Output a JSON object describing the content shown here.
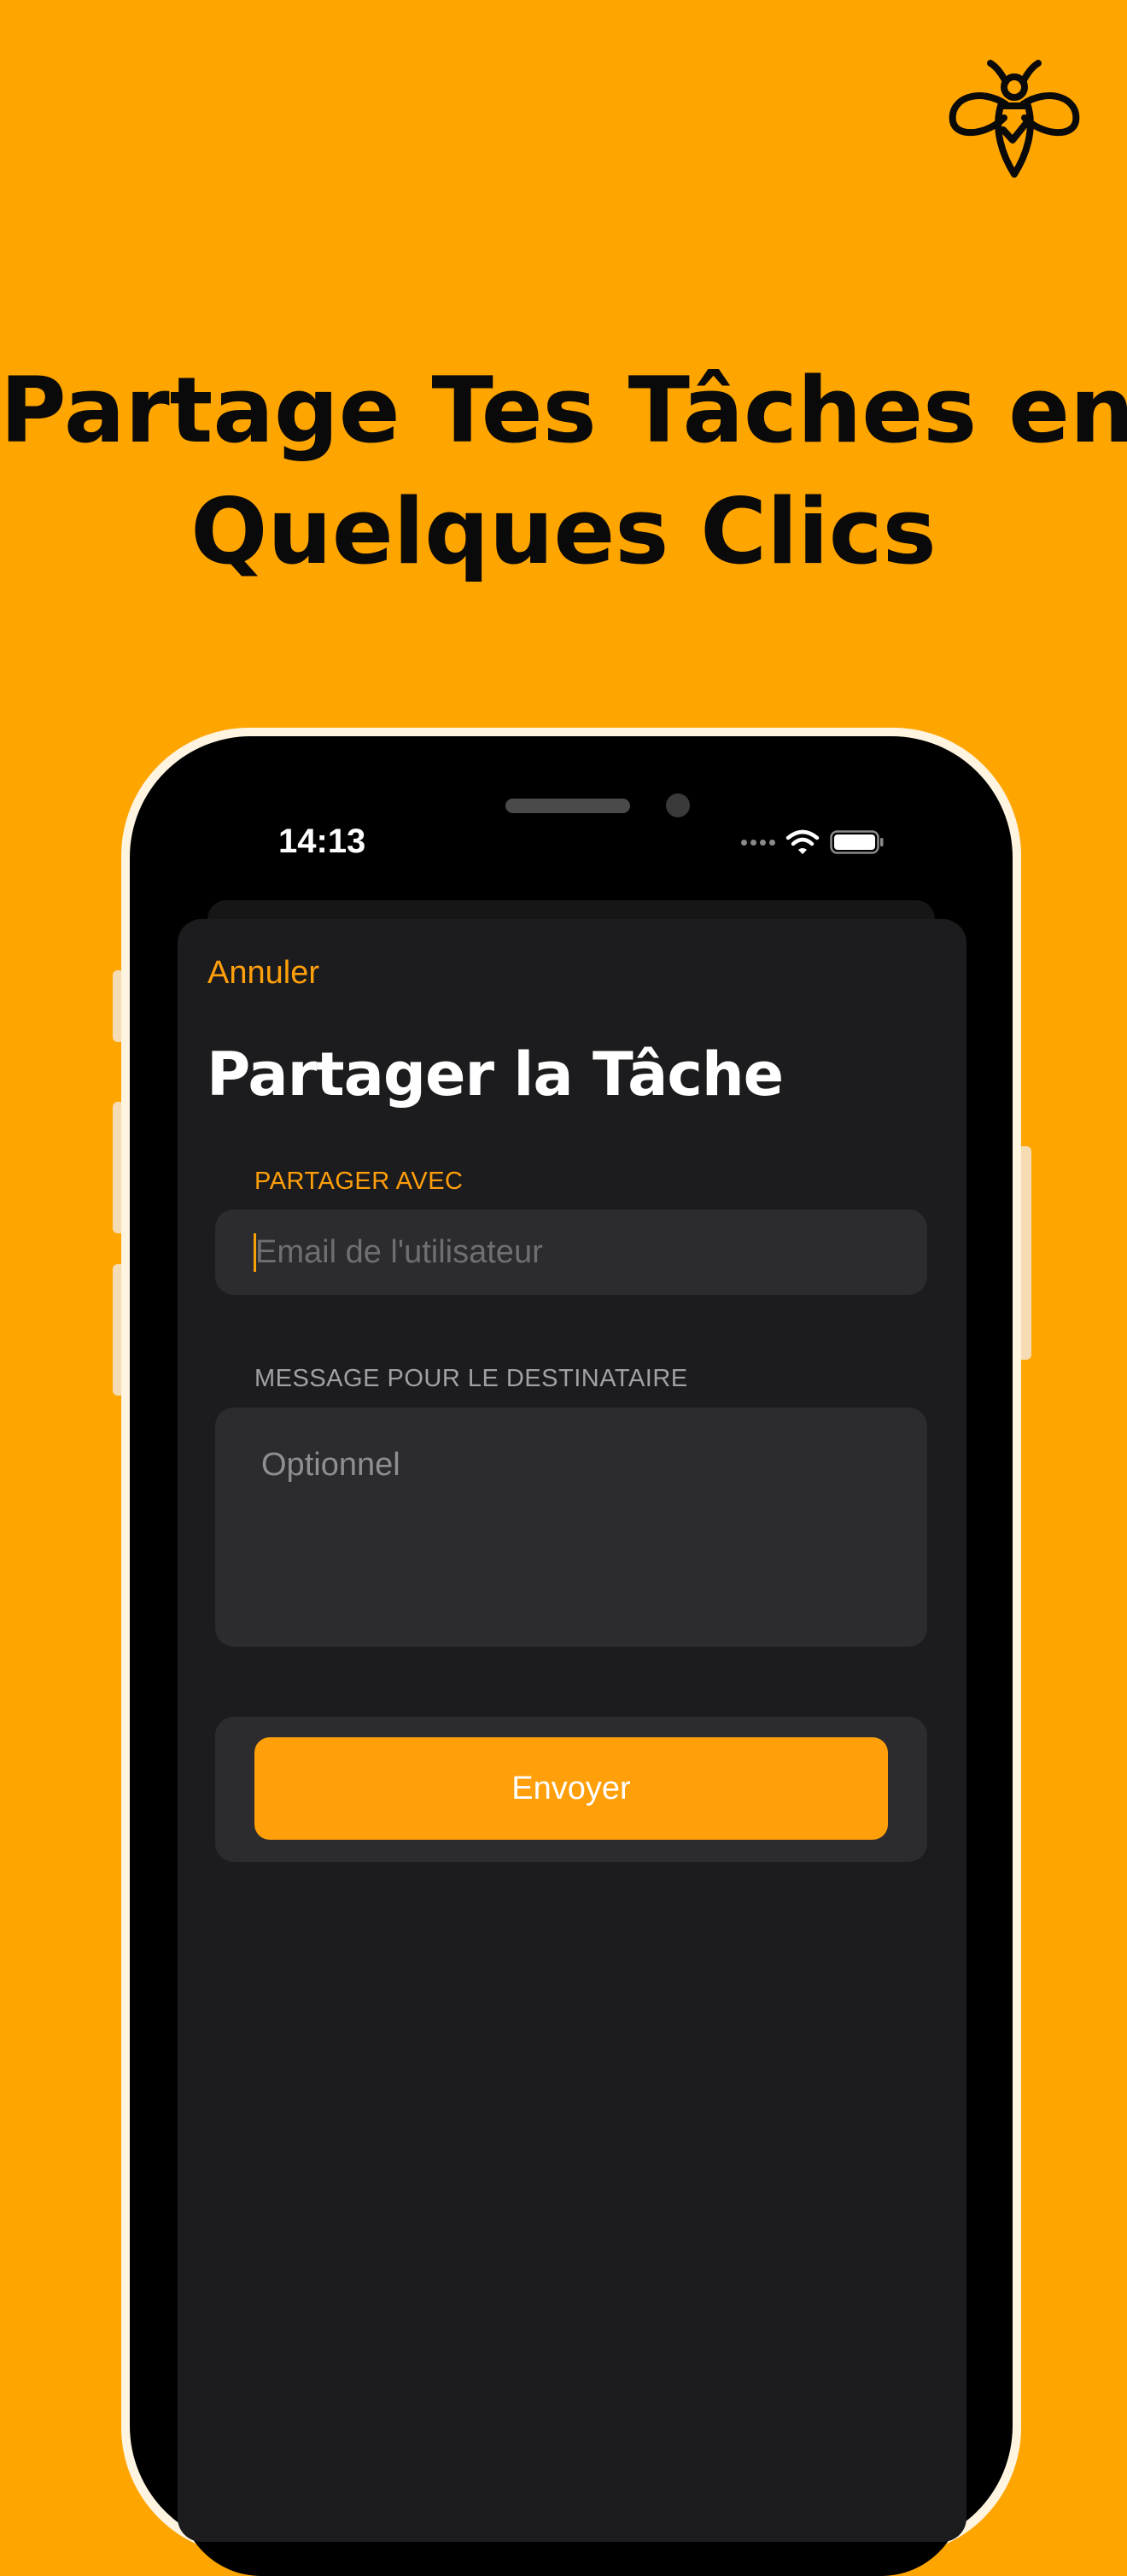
{
  "headline": {
    "line1": "Partage Tes Tâches en",
    "line2": "Quelques Clics"
  },
  "brand": {
    "logo_icon": "bee-check-icon"
  },
  "status_bar": {
    "time": "14:13",
    "icons": [
      "signal-icon",
      "wifi-icon",
      "battery-icon"
    ]
  },
  "share_sheet": {
    "cancel_label": "Annuler",
    "title": "Partager la Tâche",
    "share_with_label": "PARTAGER AVEC",
    "email_placeholder": "Email de l'utilisateur",
    "email_value": "",
    "message_label": "MESSAGE POUR LE DESTINATAIRE",
    "message_placeholder": "Optionnel",
    "message_value": "",
    "send_label": "Envoyer"
  },
  "colors": {
    "background": "#FFA500",
    "accent": "#FF9F0A",
    "sheet": "#1C1C1E",
    "field": "#2C2C2E"
  }
}
